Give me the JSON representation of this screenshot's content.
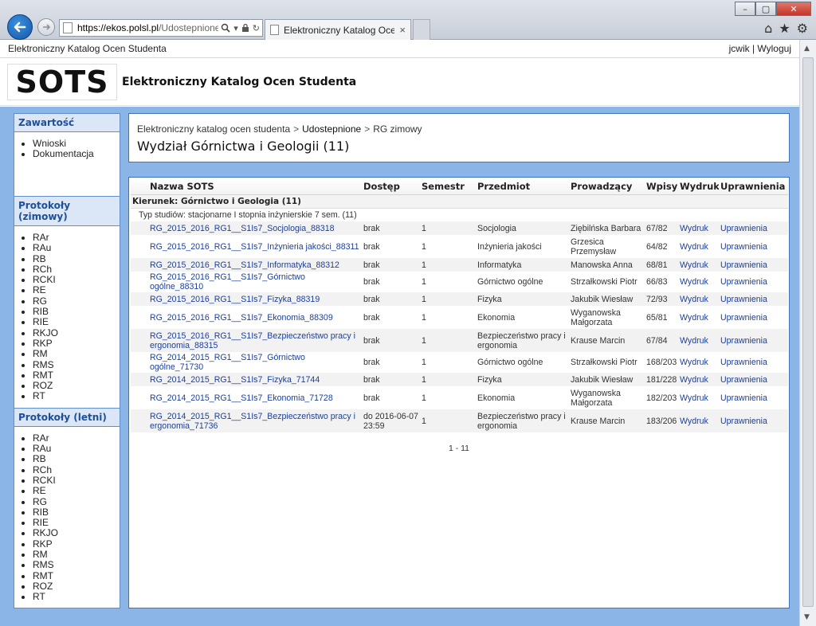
{
  "browser": {
    "url_prefix": "https://",
    "url_host": "ekos.polsl.pl",
    "url_rest": "/Udostepnione",
    "tab_title": "Elektroniczny Katalog Ocen...",
    "tab_close": "×",
    "window_controls": [
      "–",
      "▢",
      "✕"
    ],
    "toolbar_icons": [
      "home-icon",
      "star-icon",
      "gear-icon"
    ]
  },
  "topline": {
    "app_name": "Elektroniczny Katalog Ocen Studenta",
    "user": "jcwik",
    "separator": "|",
    "logout": "Wyloguj"
  },
  "header": {
    "logo": "SOTS",
    "title": "Elektroniczny Katalog Ocen Studenta"
  },
  "sidebar": {
    "zawartosc": {
      "title": "Zawartość",
      "items": [
        "Wnioski",
        "Dokumentacja"
      ]
    },
    "zimowy": {
      "title": "Protokoły (zimowy)",
      "items": [
        "RAr",
        "RAu",
        "RB",
        "RCh",
        "RCKI",
        "RE",
        "RG",
        "RIB",
        "RIE",
        "RKJO",
        "RKP",
        "RM",
        "RMS",
        "RMT",
        "ROZ",
        "RT"
      ]
    },
    "letni": {
      "title": "Protokoły (letni)",
      "items": [
        "RAr",
        "RAu",
        "RB",
        "RCh",
        "RCKI",
        "RE",
        "RG",
        "RIB",
        "RIE",
        "RKJO",
        "RKP",
        "RM",
        "RMS",
        "RMT",
        "ROZ",
        "RT"
      ]
    }
  },
  "breadcrumb": {
    "items": [
      "Elektroniczny katalog ocen studenta",
      "Udostepnione",
      "RG zimowy"
    ],
    "separator": ">"
  },
  "page_title": "Wydział Górnictwa i Geologii (11)",
  "table": {
    "columns": [
      "Nazwa SOTS",
      "Dostęp",
      "Semestr",
      "Przedmiot",
      "Prowadzący",
      "Wpisy",
      "Wydruk",
      "Uprawnienia"
    ],
    "kierunek": "Kierunek: Górnictwo i Geologia (11)",
    "typ": "Typ studiów: stacjonarne I stopnia inżynierskie 7 sem. (11)",
    "rows": [
      {
        "nazwa": "RG_2015_2016_RG1__S1Is7_Socjologia_88318",
        "dostep": "brak",
        "semestr": "1",
        "przedmiot": "Socjologia",
        "prowadzacy": "Ziębilńska Barbara",
        "wpisy": "67/82",
        "wydruk": "Wydruk",
        "uprawnienia": "Uprawnienia"
      },
      {
        "nazwa": "RG_2015_2016_RG1__S1Is7_Inżynieria jakości_88311",
        "dostep": "brak",
        "semestr": "1",
        "przedmiot": "Inżynieria jakości",
        "prowadzacy": "Grzesica Przemysław",
        "wpisy": "64/82",
        "wydruk": "Wydruk",
        "uprawnienia": "Uprawnienia"
      },
      {
        "nazwa": "RG_2015_2016_RG1__S1Is7_Informatyka_88312",
        "dostep": "brak",
        "semestr": "1",
        "przedmiot": "Informatyka",
        "prowadzacy": "Manowska Anna",
        "wpisy": "68/81",
        "wydruk": "Wydruk",
        "uprawnienia": "Uprawnienia"
      },
      {
        "nazwa": "RG_2015_2016_RG1__S1Is7_Górnictwo ogólne_88310",
        "dostep": "brak",
        "semestr": "1",
        "przedmiot": "Górnictwo ogólne",
        "prowadzacy": "Strzałkowski Piotr",
        "wpisy": "66/83",
        "wydruk": "Wydruk",
        "uprawnienia": "Uprawnienia"
      },
      {
        "nazwa": "RG_2015_2016_RG1__S1Is7_Fizyka_88319",
        "dostep": "brak",
        "semestr": "1",
        "przedmiot": "Fizyka",
        "prowadzacy": "Jakubik Wiesław",
        "wpisy": "72/93",
        "wydruk": "Wydruk",
        "uprawnienia": "Uprawnienia"
      },
      {
        "nazwa": "RG_2015_2016_RG1__S1Is7_Ekonomia_88309",
        "dostep": "brak",
        "semestr": "1",
        "przedmiot": "Ekonomia",
        "prowadzacy": "Wyganowska Małgorzata",
        "wpisy": "65/81",
        "wydruk": "Wydruk",
        "uprawnienia": "Uprawnienia"
      },
      {
        "nazwa": "RG_2015_2016_RG1__S1Is7_Bezpieczeństwo pracy i ergonomia_88315",
        "dostep": "brak",
        "semestr": "1",
        "przedmiot": "Bezpieczeństwo pracy i ergonomia",
        "prowadzacy": "Krause Marcin",
        "wpisy": "67/84",
        "wydruk": "Wydruk",
        "uprawnienia": "Uprawnienia"
      },
      {
        "nazwa": "RG_2014_2015_RG1__S1Is7_Górnictwo ogólne_71730",
        "dostep": "brak",
        "semestr": "1",
        "przedmiot": "Górnictwo ogólne",
        "prowadzacy": "Strzałkowski Piotr",
        "wpisy": "168/203",
        "wydruk": "Wydruk",
        "uprawnienia": "Uprawnienia"
      },
      {
        "nazwa": "RG_2014_2015_RG1__S1Is7_Fizyka_71744",
        "dostep": "brak",
        "semestr": "1",
        "przedmiot": "Fizyka",
        "prowadzacy": "Jakubik Wiesław",
        "wpisy": "181/228",
        "wydruk": "Wydruk",
        "uprawnienia": "Uprawnienia"
      },
      {
        "nazwa": "RG_2014_2015_RG1__S1Is7_Ekonomia_71728",
        "dostep": "brak",
        "semestr": "1",
        "przedmiot": "Ekonomia",
        "prowadzacy": "Wyganowska Małgorzata",
        "wpisy": "182/203",
        "wydruk": "Wydruk",
        "uprawnienia": "Uprawnienia"
      },
      {
        "nazwa": "RG_2014_2015_RG1__S1Is7_Bezpieczeństwo pracy i ergonomia_71736",
        "dostep": "do 2016-06-07 23:59",
        "semestr": "1",
        "przedmiot": "Bezpieczeństwo pracy i ergonomia",
        "prowadzacy": "Krause Marcin",
        "wpisy": "183/206",
        "wydruk": "Wydruk",
        "uprawnienia": "Uprawnienia"
      }
    ]
  },
  "pager": "1 - 11",
  "colors": {
    "accent_blue": "#8bb4e7",
    "border_blue": "#3f72b8",
    "link": "#1c3f99",
    "sidebar_head": "#1e4f9a"
  }
}
